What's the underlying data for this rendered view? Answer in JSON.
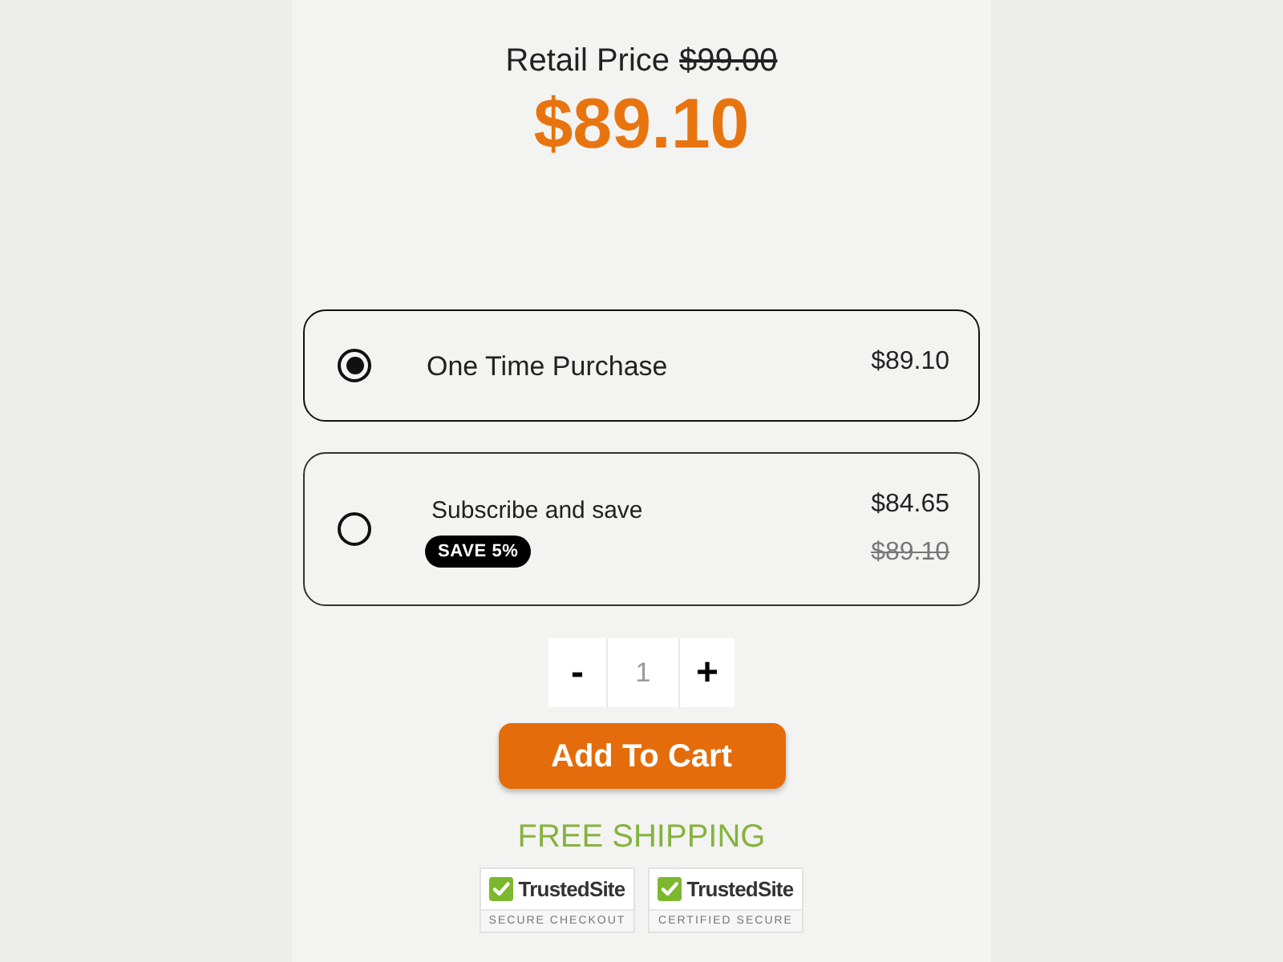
{
  "pricing": {
    "retail_label": "Retail Price",
    "retail_price": "$99.00",
    "price": "$89.10"
  },
  "purchase_options": [
    {
      "label": "One Time Purchase",
      "price": "$89.10",
      "selected": true
    },
    {
      "label": "Subscribe and save",
      "badge": "SAVE 5%",
      "price": "$84.65",
      "original_price": "$89.10",
      "selected": false
    }
  ],
  "quantity": {
    "decrement": "-",
    "value": "1",
    "increment": "+"
  },
  "add_to_cart": "Add To Cart",
  "shipping_note": "FREE SHIPPING",
  "trust_badges": [
    {
      "brand": "TrustedSite",
      "caption": "SECURE CHECKOUT"
    },
    {
      "brand": "TrustedSite",
      "caption": "CERTIFIED SECURE"
    }
  ]
}
